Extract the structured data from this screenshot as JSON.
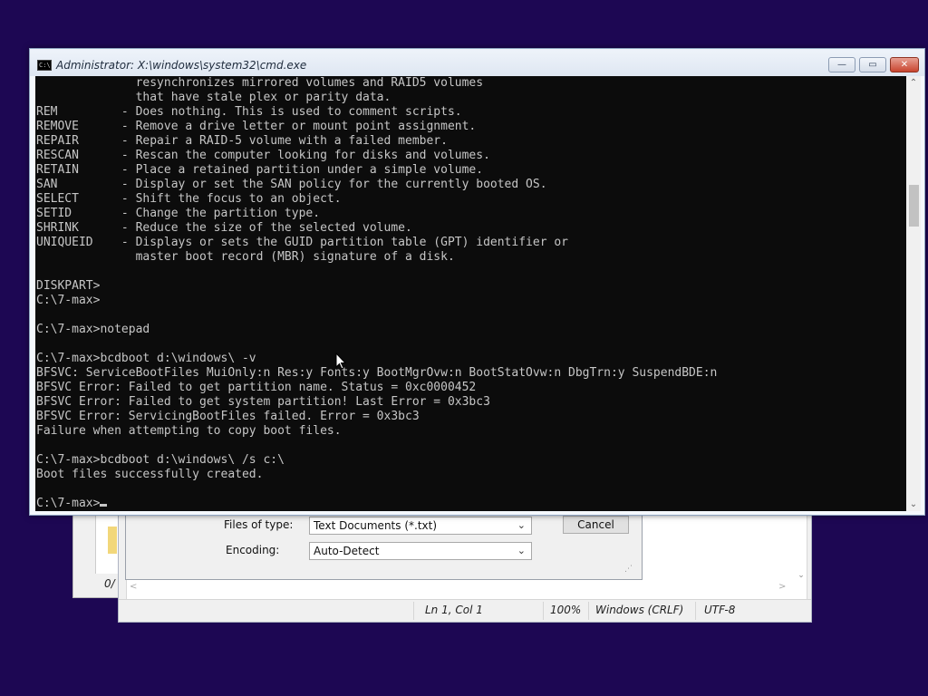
{
  "cmd": {
    "title": "Administrator: X:\\windows\\system32\\cmd.exe",
    "icon": "cmd-window-icon",
    "icon_text": "C:\\",
    "buttons": {
      "minimize": "—",
      "maximize": "▭",
      "close": "✕"
    },
    "lines": [
      "              resynchronizes mirrored volumes and RAID5 volumes",
      "              that have stale plex or parity data.",
      "REM         - Does nothing. This is used to comment scripts.",
      "REMOVE      - Remove a drive letter or mount point assignment.",
      "REPAIR      - Repair a RAID-5 volume with a failed member.",
      "RESCAN      - Rescan the computer looking for disks and volumes.",
      "RETAIN      - Place a retained partition under a simple volume.",
      "SAN         - Display or set the SAN policy for the currently booted OS.",
      "SELECT      - Shift the focus to an object.",
      "SETID       - Change the partition type.",
      "SHRINK      - Reduce the size of the selected volume.",
      "UNIQUEID    - Displays or sets the GUID partition table (GPT) identifier or",
      "              master boot record (MBR) signature of a disk.",
      "",
      "DISKPART>",
      "C:\\7-max>",
      "",
      "C:\\7-max>notepad",
      "",
      "C:\\7-max>bcdboot d:\\windows\\ -v",
      "BFSVC: ServiceBootFiles MuiOnly:n Res:y Fonts:y BootMgrOvw:n BootStatOvw:n DbgTrn:y SuspendBDE:n",
      "BFSVC Error: Failed to get partition name. Status = 0xc0000452",
      "BFSVC Error: Failed to get system partition! Last Error = 0x3bc3",
      "BFSVC Error: ServicingBootFiles failed. Error = 0x3bc3",
      "Failure when attempting to copy boot files.",
      "",
      "C:\\7-max>bcdboot d:\\windows\\ /s c:\\",
      "Boot files successfully created.",
      "",
      "C:\\7-max>"
    ]
  },
  "dialog": {
    "files_of_type_label": "Files of type:",
    "files_of_type_value": "Text Documents (*.txt)",
    "encoding_label": "Encoding:",
    "encoding_value": "Auto-Detect",
    "cancel_label": "Cancel",
    "left_label": "0/"
  },
  "notepad": {
    "status": {
      "position": "Ln 1, Col 1",
      "zoom": "100%",
      "line_ending": "Windows (CRLF)",
      "encoding": "UTF-8"
    }
  },
  "colors": {
    "desktop": "#1d0753",
    "console_bg": "#0c0c0c",
    "console_fg": "#c6c6c6",
    "close_button": "#c8452f"
  }
}
